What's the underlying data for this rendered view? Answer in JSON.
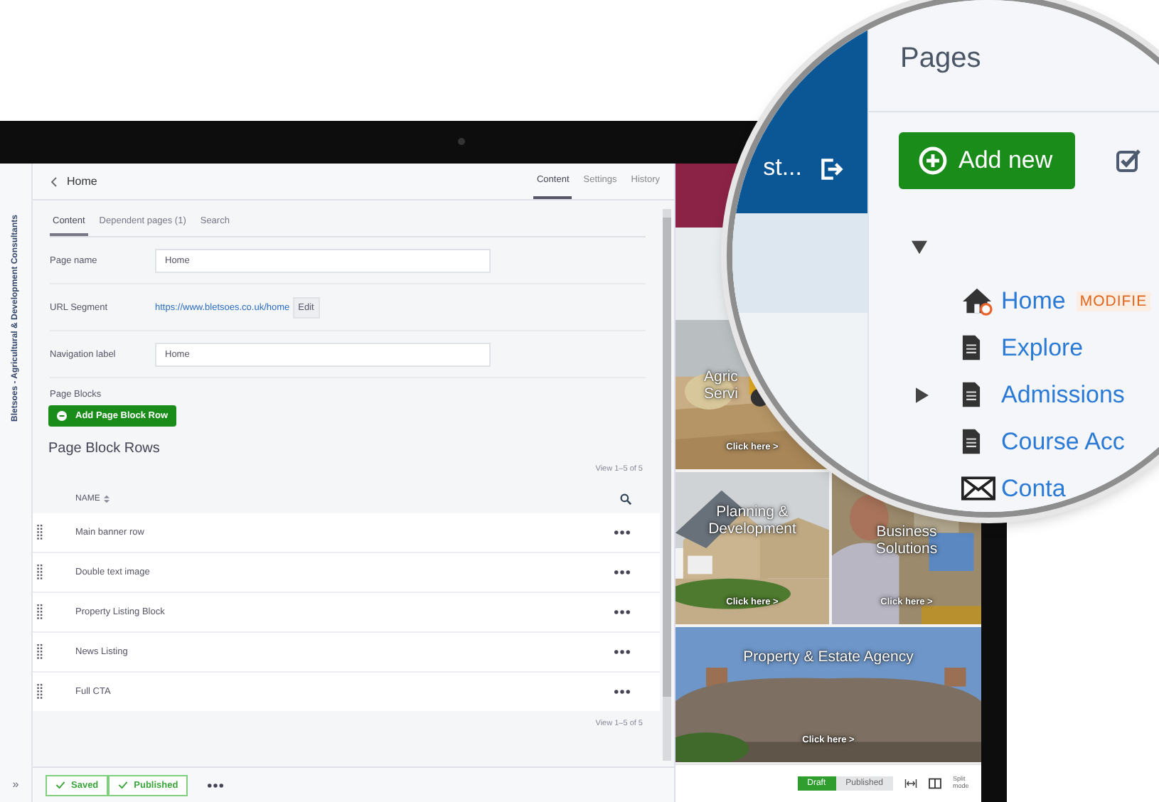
{
  "sidebar": {
    "site_title": "Bletsoes - Agricultural & Development Consultants",
    "expand_label": "»"
  },
  "editor": {
    "back_label": "Home",
    "tabs": [
      {
        "label": "Content",
        "selected": true
      },
      {
        "label": "Settings",
        "selected": false
      },
      {
        "label": "History",
        "selected": false
      }
    ],
    "subtabs": [
      {
        "label": "Content",
        "selected": true
      },
      {
        "label": "Dependent pages (1)",
        "selected": false
      },
      {
        "label": "Search",
        "selected": false
      }
    ],
    "fields": [
      {
        "kind": "input",
        "label": "Page name",
        "value": "Home"
      },
      {
        "kind": "link",
        "label": "URL Segment",
        "value": "https://www.bletsoes.co.uk/home",
        "button": "Edit"
      },
      {
        "kind": "input",
        "label": "Navigation label",
        "value": "Home"
      }
    ],
    "blocks_label": "Page Blocks",
    "add_row_button": "Add Page Block Row",
    "rows_title": "Page Block Rows",
    "count_top": "View 1–5 of 5",
    "name_column": "NAME",
    "rows": [
      {
        "name": "Main banner row"
      },
      {
        "name": "Double text image"
      },
      {
        "name": "Property Listing Block"
      },
      {
        "name": "News Listing"
      },
      {
        "name": "Full CTA"
      }
    ],
    "count_bottom": "View 1–5 of 5"
  },
  "footer": {
    "status_buttons": [
      {
        "label": "Saved"
      },
      {
        "label": "Published"
      }
    ]
  },
  "preview": {
    "tiles": [
      {
        "title_lines": [
          "Agric",
          "Servi"
        ],
        "link": "Click here >"
      },
      {
        "title_lines": [
          "Planning &",
          "Development"
        ],
        "link": "Click here >"
      },
      {
        "title_lines": [
          "Business",
          "Solutions"
        ],
        "link": "Click here >"
      },
      {
        "title_lines": [
          "Property & Estate Agency"
        ],
        "link": "Click here >"
      }
    ],
    "modes": [
      {
        "label": "Draft",
        "selected": true
      },
      {
        "label": "Published",
        "selected": false
      }
    ],
    "split_label": "Split mode"
  },
  "magnifier": {
    "site_label": "st...",
    "panel_title": "Pages",
    "add_button": "Add new",
    "tree": {
      "expanded": true,
      "children": [
        {
          "kind": "home",
          "label": "Home",
          "badge": "MODIFIE",
          "expandable": false
        },
        {
          "kind": "page",
          "label": "Explore",
          "expandable": false
        },
        {
          "kind": "page",
          "label": "Admissions",
          "expandable": true
        },
        {
          "kind": "page",
          "label": "Course Acc",
          "expandable": false
        },
        {
          "kind": "contact",
          "label": "Conta",
          "expandable": false
        }
      ]
    }
  }
}
